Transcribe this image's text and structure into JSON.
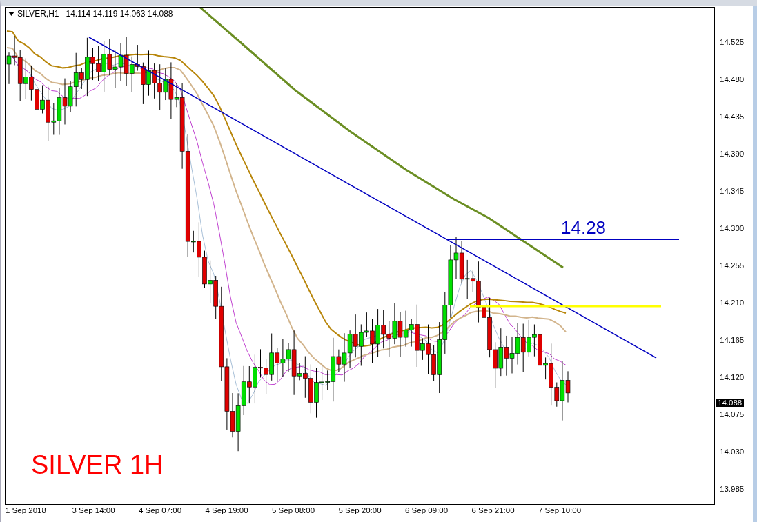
{
  "header": {
    "symbol": "SILVER,H1",
    "quote": "14.114 14.119 14.063 14.088"
  },
  "chart": {
    "level_label": "14.28",
    "caption": "SILVER 1H",
    "current_price": "14.088"
  },
  "price_axis": [
    "14.525",
    "14.480",
    "14.435",
    "14.390",
    "14.345",
    "14.300",
    "14.255",
    "14.210",
    "14.165",
    "14.120",
    "14.075",
    "14.030",
    "13.985"
  ],
  "time_axis": [
    "1 Sep 2018",
    "3 Sep 14:00",
    "4 Sep 07:00",
    "4 Sep 19:00",
    "5 Sep 08:00",
    "5 Sep 20:00",
    "6 Sep 09:00",
    "6 Sep 21:00",
    "7 Sep 10:00"
  ]
}
